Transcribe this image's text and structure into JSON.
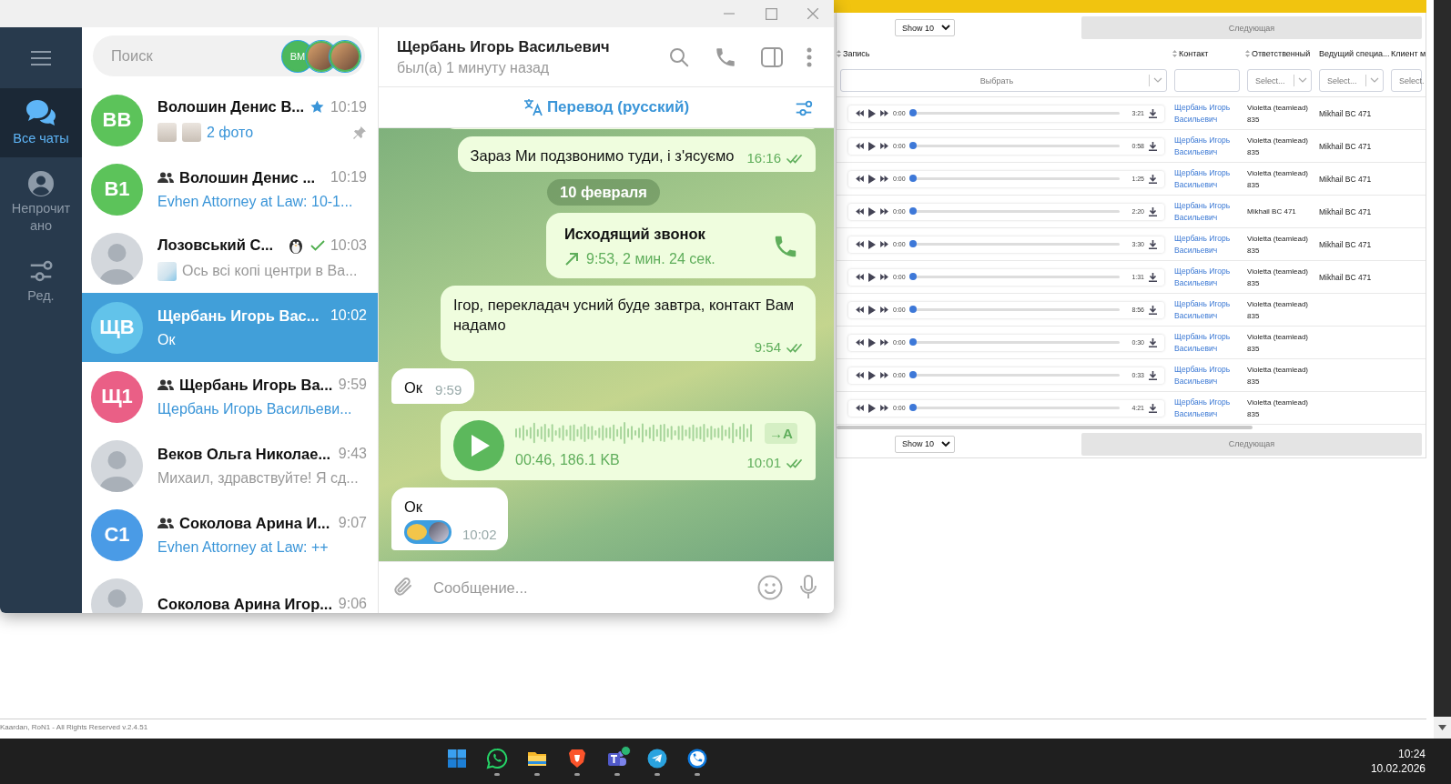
{
  "telegram": {
    "folders": [
      {
        "kind": "chats",
        "label": "Все чаты",
        "selected": true
      },
      {
        "kind": "person",
        "label": "Непрочитано",
        "selected": false
      },
      {
        "kind": "sliders",
        "label": "Ред.",
        "selected": false
      }
    ],
    "search": {
      "placeholder": "Поиск"
    },
    "stories": [
      {
        "kind": "initials",
        "text": "ВМ",
        "color": "#4cb85c"
      },
      {
        "kind": "photo"
      },
      {
        "kind": "photo"
      }
    ],
    "chats": [
      {
        "avatar": {
          "kind": "initials",
          "text": "ВВ",
          "color": "#5cc35a"
        },
        "group": false,
        "name": "Волошин Денис В...",
        "emoji_status": {
          "kind": "star"
        },
        "sent": false,
        "time": "10:19",
        "attachments": [
          {
            "kind": "photo"
          },
          {
            "kind": "photo"
          }
        ],
        "preview": {
          "kind": "accent",
          "text": "2 фото"
        },
        "pinned": true,
        "selected": false
      },
      {
        "avatar": {
          "kind": "initials",
          "text": "В1",
          "color": "#5cc35a"
        },
        "group": true,
        "name": "Волошин Денис ...",
        "sent": false,
        "time": "10:19",
        "preview": {
          "kind": "accent",
          "text": "Evhen Attorney at Law: 10-1..."
        },
        "pinned": false,
        "selected": false
      },
      {
        "avatar": {
          "kind": "photo"
        },
        "group": false,
        "name": "Лозовський С...",
        "emoji_status": {
          "kind": "penguin"
        },
        "sent": true,
        "time": "10:03",
        "attachments": [
          {
            "kind": "map"
          }
        ],
        "preview": {
          "kind": "muted",
          "text": "Ось всі копі центри в Ва..."
        },
        "pinned": false,
        "selected": false
      },
      {
        "avatar": {
          "kind": "initials",
          "text": "ЩВ",
          "color": "#62c3ea"
        },
        "group": false,
        "name": "Щербань Игорь Вас...",
        "sent": false,
        "time": "10:02",
        "preview": {
          "kind": "muted",
          "text": "Ок"
        },
        "pinned": false,
        "selected": true
      },
      {
        "avatar": {
          "kind": "initials",
          "text": "Щ1",
          "color": "#ea5f86"
        },
        "group": true,
        "name": "Щербань Игорь Ва...",
        "sent": false,
        "time": "9:59",
        "preview": {
          "kind": "accent",
          "text": "Щербань Игорь Васильеви..."
        },
        "pinned": false,
        "selected": false
      },
      {
        "avatar": {
          "kind": "photo"
        },
        "group": false,
        "name": "Веков Ольга Николае...",
        "sent": false,
        "time": "9:43",
        "preview": {
          "kind": "muted",
          "text": "Михаил, здравствуйте! Я сд..."
        },
        "pinned": false,
        "selected": false
      },
      {
        "avatar": {
          "kind": "initials",
          "text": "С1",
          "color": "#4a9be6"
        },
        "group": true,
        "name": "Соколова Арина И...",
        "sent": false,
        "time": "9:07",
        "preview": {
          "kind": "accent",
          "text": "Evhen Attorney at Law: ++"
        },
        "pinned": false,
        "selected": false
      },
      {
        "avatar": {
          "kind": "photo"
        },
        "group": false,
        "name": "Соколова Арина Игор...",
        "sent": false,
        "time": "9:06",
        "pinned": false,
        "selected": false
      }
    ],
    "header": {
      "title": "Щербань Игорь Васильевич",
      "status": "был(а) 1 минуту назад"
    },
    "translate": {
      "label": "Перевод (русский)"
    },
    "messages": [
      {
        "kind": "stub",
        "outgoing": true
      },
      {
        "kind": "text",
        "outgoing": true,
        "text": "Зараз Ми подзвонимо туди, і з'ясуємо",
        "time": "16:16",
        "read": true
      },
      {
        "kind": "date",
        "text": "10 февраля"
      },
      {
        "kind": "call",
        "outgoing": true,
        "title": "Исходящий звонок",
        "detail": "9:53, 2 мин. 24 сек."
      },
      {
        "kind": "text",
        "outgoing": true,
        "text": "Ігор, перекладач усний буде завтра, контакт Вам надамо",
        "time": "9:54",
        "read": true
      },
      {
        "kind": "text",
        "outgoing": false,
        "text": "Ок",
        "time": "9:59"
      },
      {
        "kind": "voice",
        "outgoing": true,
        "info": "00:46, 186.1 KB",
        "transcribe": "→A",
        "time": "10:01",
        "read": true
      },
      {
        "kind": "text",
        "outgoing": false,
        "text": "Ок",
        "time": "10:02",
        "reaction": true
      }
    ],
    "composer": {
      "placeholder": "Сообщение..."
    }
  },
  "web": {
    "pagination_top": {
      "page_size": "Show 10",
      "next": "Следующая"
    },
    "columns": [
      "Запись",
      "Контакт",
      "Ответственный",
      "Ведущий специа...",
      "Клиент м"
    ],
    "filters": [
      {
        "kind": "select",
        "label": "Выбрать"
      },
      {
        "kind": "input"
      },
      {
        "kind": "select",
        "label": "Select..."
      },
      {
        "kind": "select",
        "label": "Select..."
      },
      {
        "kind": "select",
        "label": "Select."
      }
    ],
    "rows": [
      {
        "position": "0:00",
        "duration": "3:21",
        "level": 0,
        "contact": "Щербань Игорь Васильевич",
        "responsible": "Violetta (teamlead) 835",
        "lead": "Mikhail BC 471"
      },
      {
        "position": "0:00",
        "duration": "0:58",
        "level": 0,
        "contact": "Щербань Игорь Васильевич",
        "responsible": "Violetta (teamlead) 835",
        "lead": "Mikhail BC 471"
      },
      {
        "position": "0:00",
        "duration": "1:25",
        "level": 0,
        "contact": "Щербань Игорь Васильевич",
        "responsible": "Violetta (teamlead) 835",
        "lead": "Mikhail BC 471"
      },
      {
        "position": "0:00",
        "duration": "2:20",
        "level": 0,
        "contact": "Щербань Игорь Васильевич",
        "responsible": "Mikhail BC 471",
        "lead": "Mikhail BC 471"
      },
      {
        "position": "0:00",
        "duration": "3:30",
        "level": 0,
        "contact": "Щербань Игорь Васильевич",
        "responsible": "Violetta (teamlead) 835",
        "lead": "Mikhail BC 471"
      },
      {
        "position": "0:00",
        "duration": "1:31",
        "level": 0,
        "contact": "Щербань Игорь Васильевич",
        "responsible": "Violetta (teamlead) 835",
        "lead": "Mikhail BC 471"
      },
      {
        "position": "0:00",
        "duration": "8:56",
        "level": 0,
        "contact": "Щербань Игорь Васильевич",
        "responsible": "Violetta (teamlead) 835"
      },
      {
        "position": "0:00",
        "duration": "0:30",
        "level": 0,
        "contact": "Щербань Игорь Васильевич",
        "responsible": "Violetta (teamlead) 835"
      },
      {
        "position": "0:00",
        "duration": "0:33",
        "level": 0,
        "contact": "Щербань Игорь Васильевич",
        "responsible": "Violetta (teamlead) 835"
      },
      {
        "position": "0:00",
        "duration": "4:21",
        "level": 0,
        "contact": "Щербань Игорь Васильевич",
        "responsible": "Violetta (teamlead) 835"
      }
    ],
    "pagination_bottom": {
      "page_size": "Show 10",
      "next": "Следующая"
    },
    "footer": "Kaardan, RoN1 - All Rights Reserved v.2.4.51"
  },
  "taskbar": {
    "apps": [
      {
        "kind": "start",
        "running": false,
        "badge": false
      },
      {
        "kind": "chat-phone",
        "running": true,
        "badge": false
      },
      {
        "kind": "folder",
        "running": true,
        "badge": false
      },
      {
        "kind": "shield",
        "running": true,
        "badge": false
      },
      {
        "kind": "people",
        "running": true,
        "badge": true
      },
      {
        "kind": "plane",
        "running": true,
        "badge": false
      },
      {
        "kind": "phone",
        "running": true,
        "badge": false
      }
    ],
    "time": "10:24",
    "date": "10.02.2026"
  }
}
